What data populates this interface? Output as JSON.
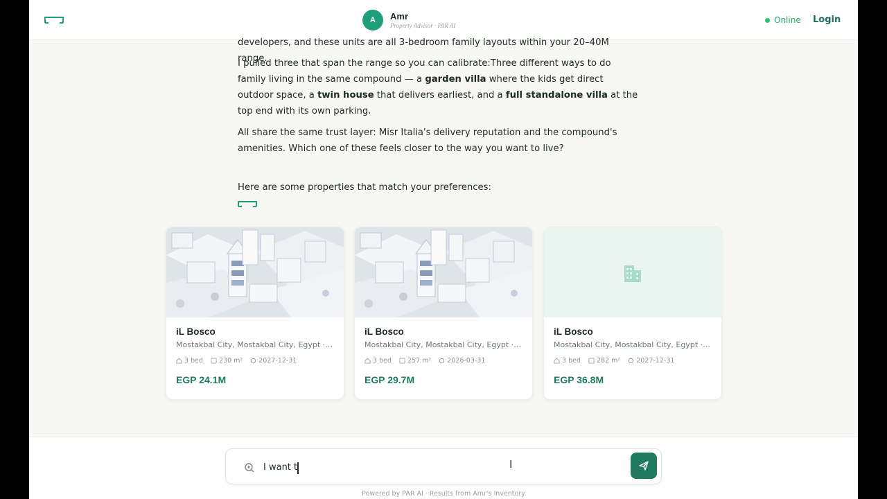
{
  "header": {
    "avatar_letter": "A",
    "advisor_name": "Amr",
    "advisor_role": "Property Advisor · PAR AI",
    "status": "Online",
    "login_label": "Login"
  },
  "chat": {
    "partial_line": "developers, and these units are all 3-bedroom family layouts within your 20–40M range.",
    "p2_a": "I pulled three that span the range so you can calibrate:Three different ways to do family living in the same compound — a ",
    "p2_b1": "garden villa",
    "p2_c": " where the kids get direct outdoor space, a ",
    "p2_b2": "twin house",
    "p2_d": " that delivers earliest, and a ",
    "p2_b3": "full standalone villa",
    "p2_e": " at the top end with its own parking.",
    "p3": "All share the same trust layer: Misr Italia's delivery reputation and the compound's amenities. Which one of these feels closer to the way you want to live?",
    "intro": "Here are some properties that match your preferences:"
  },
  "properties": [
    {
      "name": "iL Bosco",
      "location": "Mostakbal City, Mostakbal City, Egypt · Misr Italia",
      "beds": "3 bed",
      "area": "230 m²",
      "delivery": "2027-12-31",
      "price": "EGP 24.1M",
      "image": "city-render"
    },
    {
      "name": "iL Bosco",
      "location": "Mostakbal City, Mostakbal City, Egypt · Misr Italia",
      "beds": "3 bed",
      "area": "257 m²",
      "delivery": "2026-03-31",
      "price": "EGP 29.7M",
      "image": "city-render"
    },
    {
      "name": "iL Bosco",
      "location": "Mostakbal City, Mostakbal City, Egypt · Misr Italia",
      "beds": "3 bed",
      "area": "282 m²",
      "delivery": "2027-12-31",
      "price": "EGP 36.8M",
      "image": "building-placeholder-icon"
    }
  ],
  "input": {
    "value": "I want t"
  },
  "footer": {
    "note": "Powered by PAR AI · Results from Amr's Inventory"
  },
  "colors": {
    "brand": "#1f7a5f",
    "avatar": "#1f9e7c",
    "online": "#30c26b",
    "background": "#f7f8f3"
  },
  "icons": {
    "logo": "bracket-logo-icon",
    "input": "search-ai-icon",
    "send": "send-icon",
    "beds": "home-icon",
    "area": "area-icon",
    "delivery": "calendar-pin-icon"
  }
}
